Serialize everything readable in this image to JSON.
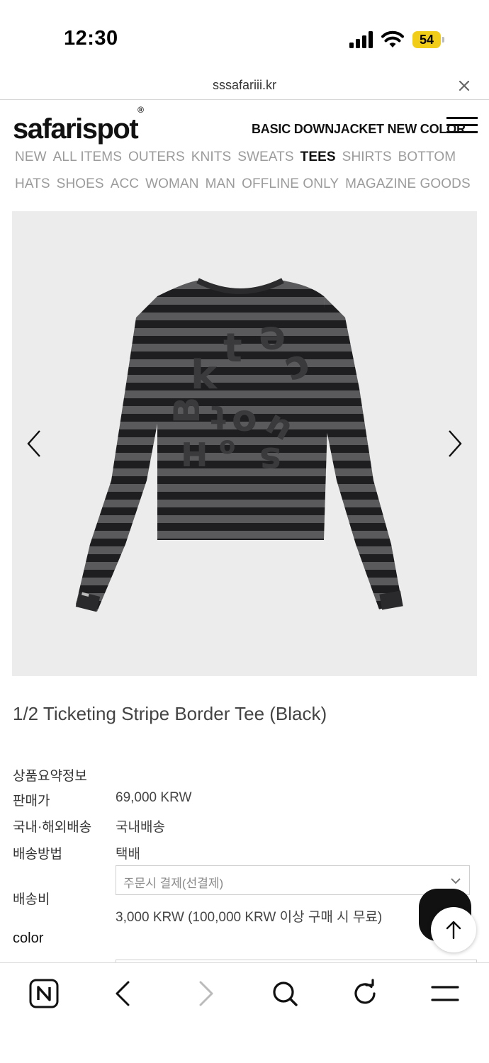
{
  "status_bar": {
    "time": "12:30",
    "battery": "54",
    "icons": [
      "signal-icon",
      "wifi-icon",
      "battery-icon"
    ]
  },
  "browser": {
    "url": "sssafariii.kr"
  },
  "site": {
    "logo": "safarispot",
    "logo_mark": "®",
    "promo": "BASIC DOWNJACKET NEW COLOR",
    "nav_row1": [
      {
        "label": "NEW",
        "active": false
      },
      {
        "label": "ALL ITEMS",
        "active": false
      },
      {
        "label": "OUTERS",
        "active": false
      },
      {
        "label": "KNITS",
        "active": false
      },
      {
        "label": "SWEATS",
        "active": false
      },
      {
        "label": "TEES",
        "active": true
      },
      {
        "label": "SHIRTS",
        "active": false
      },
      {
        "label": "BOTTOM",
        "active": false
      }
    ],
    "nav_row2": [
      {
        "label": "HATS",
        "active": false
      },
      {
        "label": "SHOES",
        "active": false
      },
      {
        "label": "ACC",
        "active": false
      },
      {
        "label": "WOMAN",
        "active": false
      },
      {
        "label": "MAN",
        "active": false
      },
      {
        "label": "OFFLINE ONLY",
        "active": false
      },
      {
        "label": "MAGAZINE GOODS",
        "active": false
      }
    ]
  },
  "product": {
    "title": "1/2 Ticketing Stripe Border Tee (Black)",
    "summary_label": "상품요약정보",
    "price_label": "판매가",
    "price_value": "69,000 KRW",
    "shipping_region_label": "국내·해외배송",
    "shipping_region_value": "국내배송",
    "shipping_method_label": "배송방법",
    "shipping_method_value": "택배",
    "shipping_fee_label": "배송비",
    "shipping_fee_select": "주문시 결제(선결제)",
    "shipping_fee_value": "3,000 KRW (100,000 KRW 이상 구매 시 무료)",
    "color_label": "color",
    "colors": {
      "stripe_dark": "#1e1e20",
      "stripe_light": "#5a5a5c",
      "print": "#38383a",
      "image_bg": "#ececec"
    }
  }
}
